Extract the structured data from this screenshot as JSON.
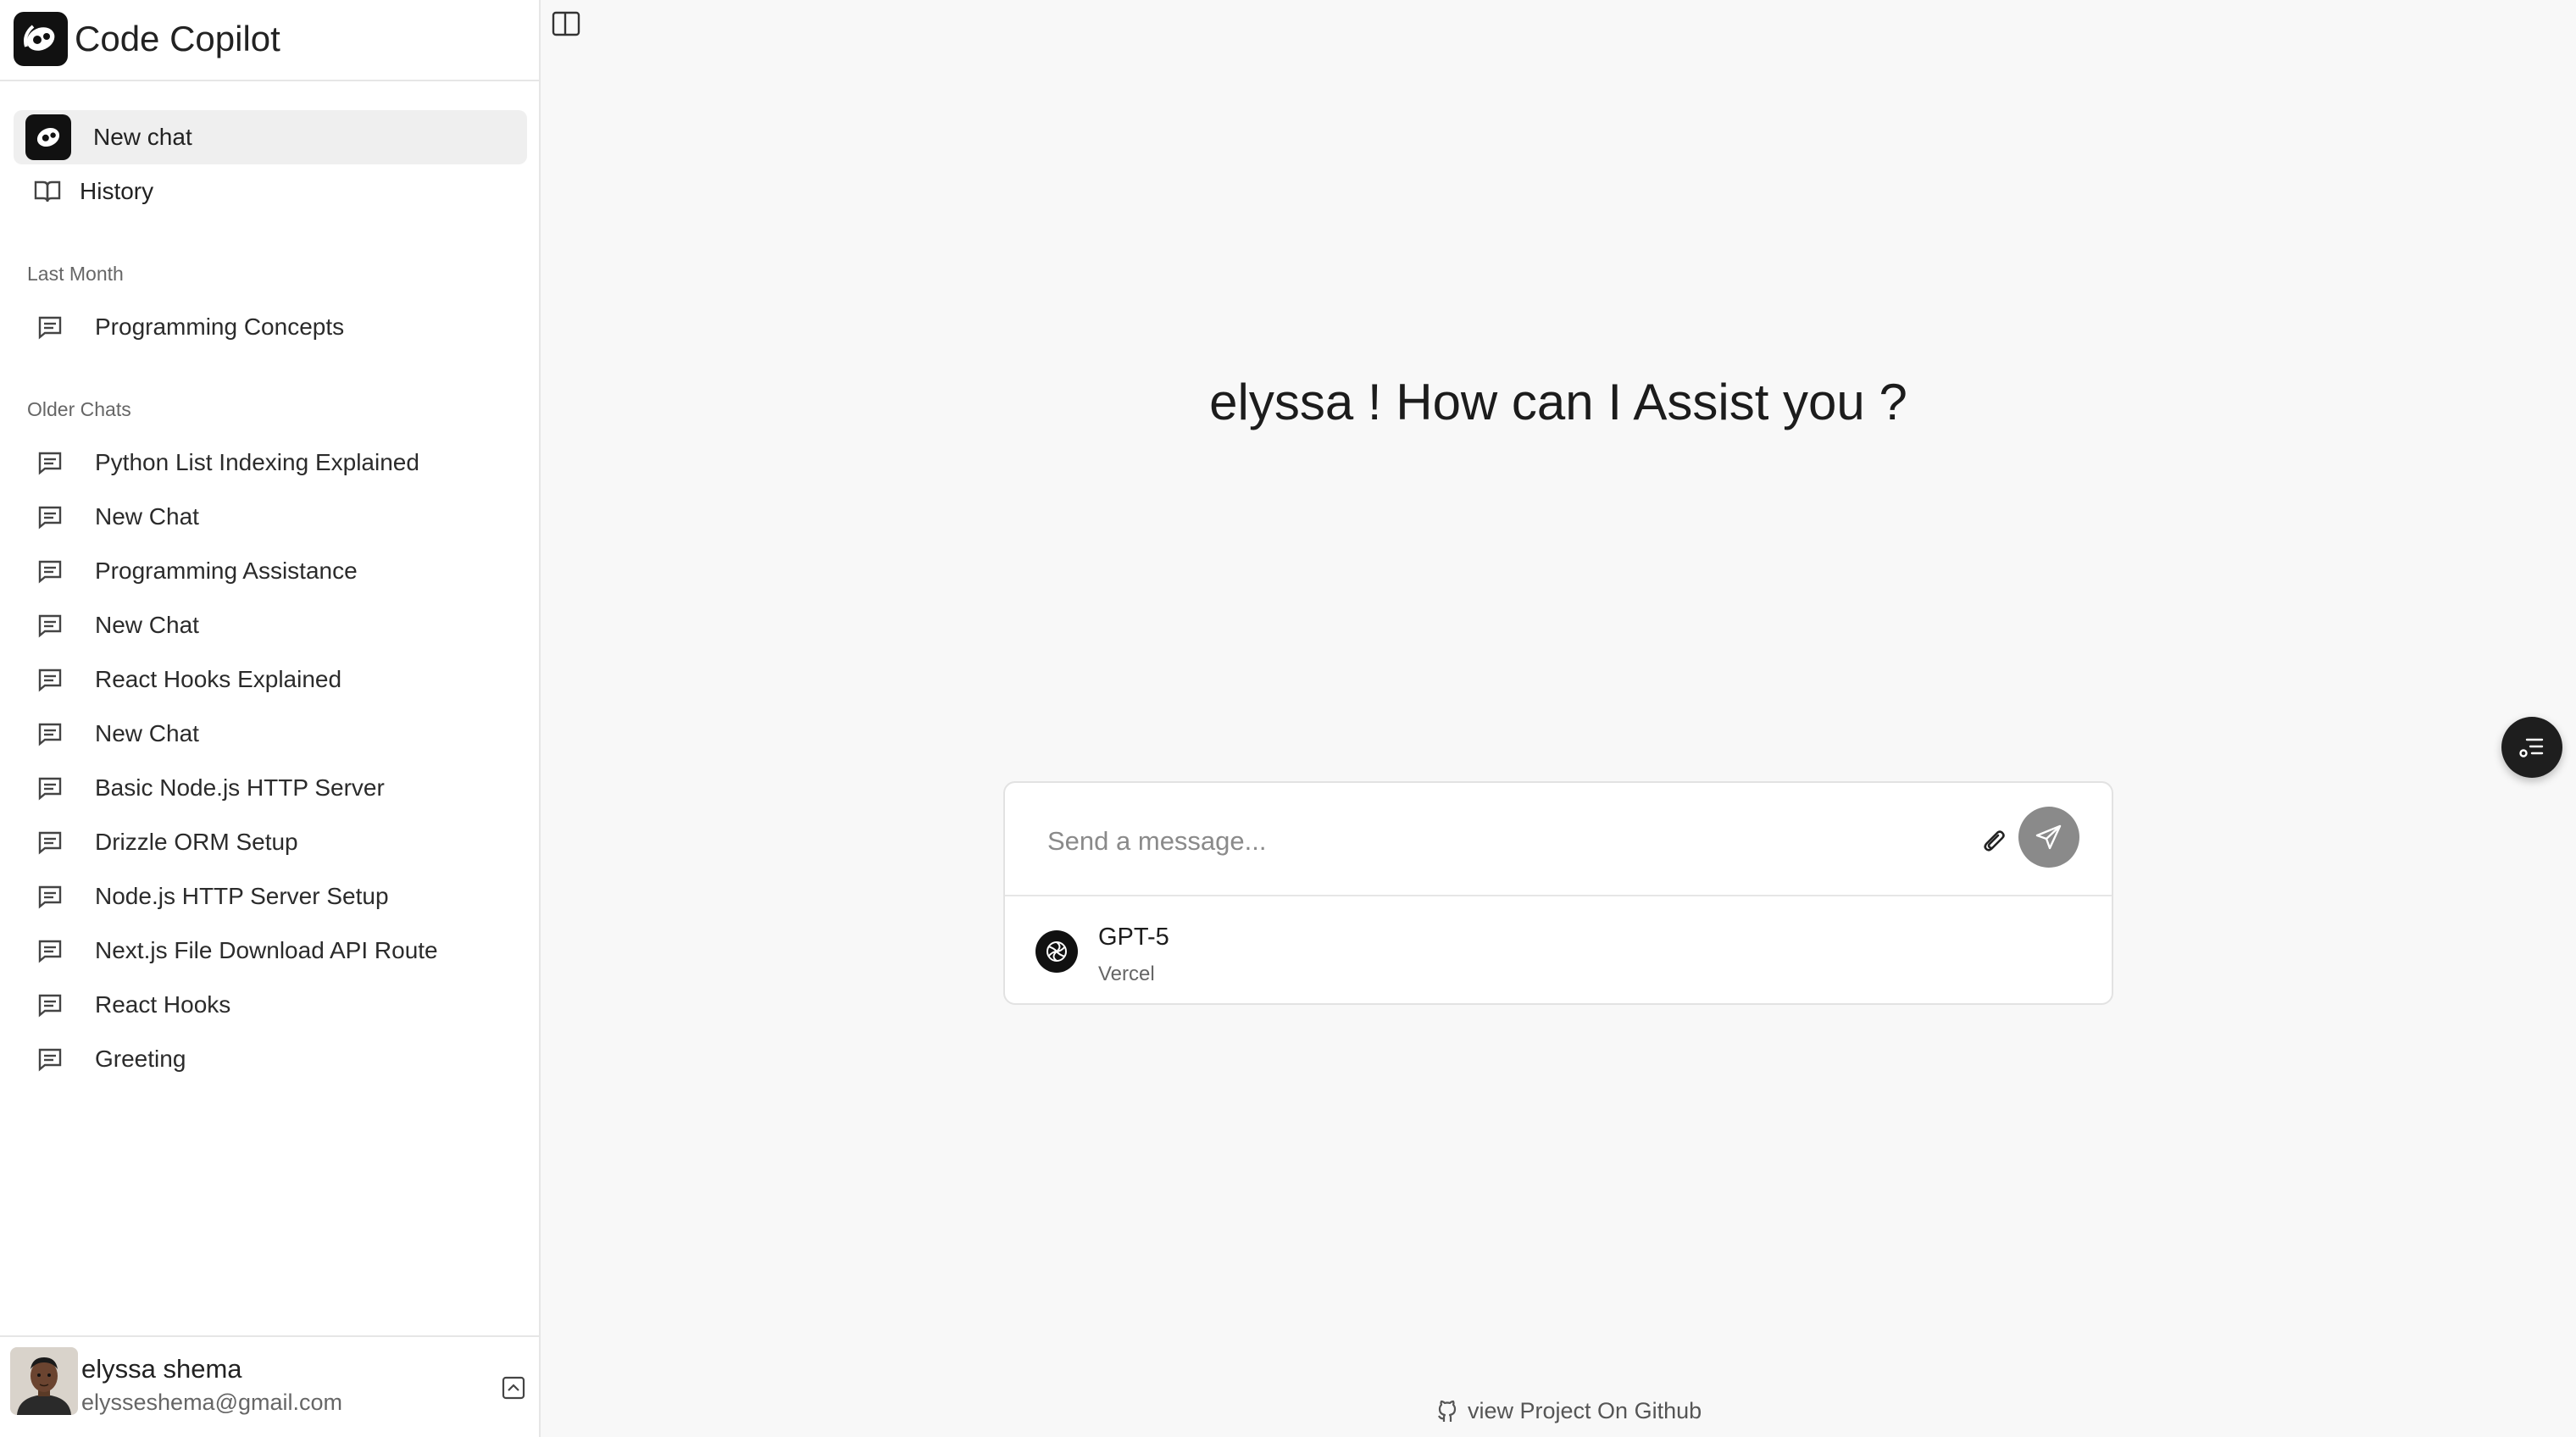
{
  "app": {
    "title": "Code Copilot"
  },
  "nav": {
    "new_chat": "New chat",
    "history": "History"
  },
  "sections": [
    {
      "label": "Last Month",
      "chats": [
        "Programming Concepts"
      ]
    },
    {
      "label": "Older Chats",
      "chats": [
        "Python List Indexing Explained",
        "New Chat",
        "Programming Assistance",
        "New Chat",
        "React Hooks Explained",
        "New Chat",
        "Basic Node.js HTTP Server",
        "Drizzle ORM Setup",
        "Node.js HTTP Server Setup",
        "Next.js File Download API Route",
        "React Hooks",
        "Greeting"
      ]
    }
  ],
  "user": {
    "name": "elyssa shema",
    "email": "elysseshema@gmail.com"
  },
  "main": {
    "greeting": "elyssa ! How can I Assist you ?",
    "composer": {
      "placeholder": "Send a message..."
    },
    "model": {
      "name": "GPT-5",
      "provider": "Vercel"
    },
    "footer_link": "view Project On Github"
  },
  "icons": {
    "brand": "brand-logo-icon",
    "history": "book-icon",
    "chat": "message-square-icon",
    "attach": "paperclip-icon",
    "send": "send-icon",
    "sidebar_toggle": "panel-left-icon",
    "fab": "list-settings-icon",
    "github": "github-icon"
  },
  "colors": {
    "accent_dark": "#111111",
    "send_button": "#8a8a8a",
    "background": "#f8f8f8"
  }
}
